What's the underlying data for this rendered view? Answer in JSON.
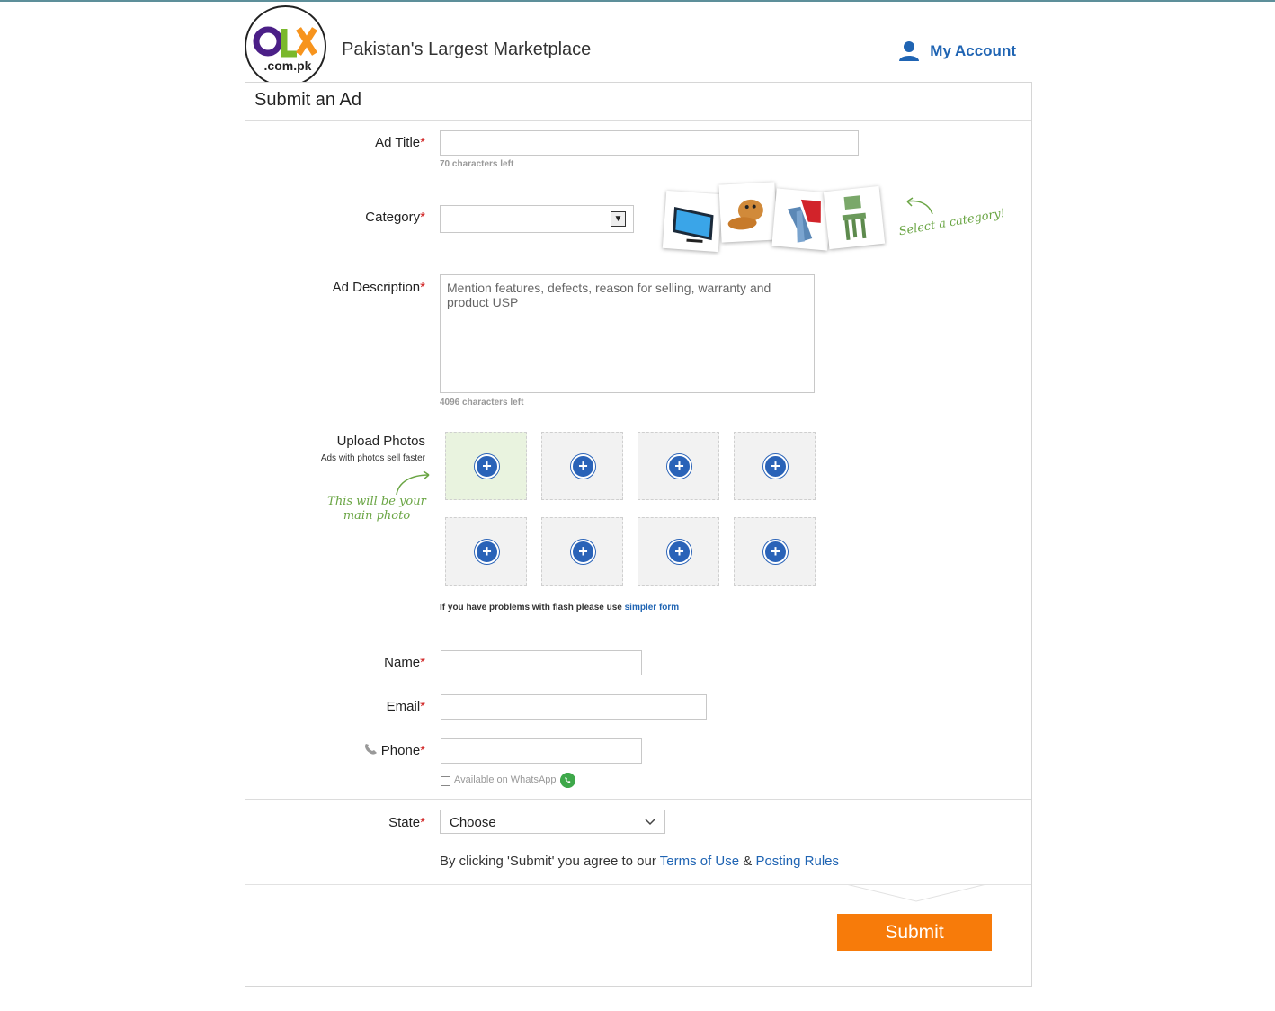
{
  "header": {
    "logo_text": "OLX",
    "logo_domain": ".com.pk",
    "tagline": "Pakistan's Largest Marketplace",
    "account_label": "My Account"
  },
  "form": {
    "title": "Submit an Ad",
    "required_mark": "*",
    "ad_title": {
      "label": "Ad Title",
      "value": "",
      "hint": "70 characters left"
    },
    "category": {
      "label": "Category",
      "value": "",
      "note": "Select a category!"
    },
    "description": {
      "label": "Ad Description",
      "placeholder": "Mention features, defects, reason for selling, warranty and product USP",
      "hint": "4096 characters left"
    },
    "photos": {
      "label": "Upload Photos",
      "sub": "Ads with photos sell faster",
      "main_note": "This will be your main photo",
      "slot_symbol": "+",
      "flash_note_prefix": "If you have problems with flash please use ",
      "flash_link": "simpler form"
    },
    "name": {
      "label": "Name",
      "value": ""
    },
    "email": {
      "label": "Email",
      "value": ""
    },
    "phone": {
      "label": "Phone",
      "value": "",
      "whatsapp_label": "Available on WhatsApp"
    },
    "state": {
      "label": "State",
      "value": "Choose"
    },
    "terms": {
      "prefix": "By clicking 'Submit' you agree to our ",
      "terms_link": "Terms of Use",
      "joiner": " & ",
      "rules_link": "Posting Rules"
    },
    "submit_label": "Submit"
  },
  "icons": {
    "account": "user-icon",
    "phone": "phone-icon",
    "whatsapp": "whatsapp-icon",
    "plus": "plus-icon"
  },
  "colors": {
    "brand_blue": "#1f64b3",
    "submit_orange": "#f77b0a",
    "required_red": "#d02020",
    "note_green": "#6aa544"
  }
}
